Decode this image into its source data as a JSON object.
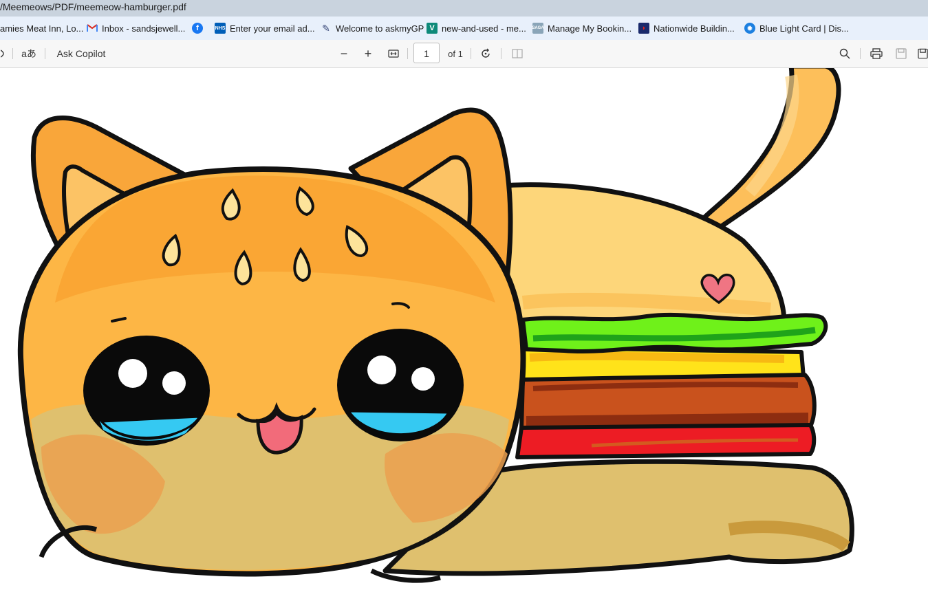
{
  "address": {
    "path": "/Meemeows/PDF/meemeow-hamburger.pdf"
  },
  "bookmarks": [
    {
      "label": "amies Meat Inn, Lo...",
      "icon": "",
      "color": ""
    },
    {
      "label": "Inbox - sandsjewell...",
      "icon": "gmail-icon",
      "color": "#d93025"
    },
    {
      "label": "",
      "icon": "facebook-icon",
      "color": "#1877f2"
    },
    {
      "label": "Enter your email ad...",
      "icon": "nhs-icon",
      "color": "#005eb8"
    },
    {
      "label": "Welcome to askmyGP",
      "icon": "askmygp-icon",
      "color": "#3b4a7a"
    },
    {
      "label": "new-and-used - me...",
      "icon": "v-icon",
      "color": "#0e8a7a"
    },
    {
      "label": "Manage My Bookin...",
      "icon": "saga-icon",
      "color": "#8aa5b8"
    },
    {
      "label": "Nationwide Buildin...",
      "icon": "nationwide-icon",
      "color": "#1a2a6c"
    },
    {
      "label": "Blue Light Card | Dis...",
      "icon": "bluelight-icon",
      "color": "#1b7fe0"
    }
  ],
  "toolbar": {
    "read_aloud_icon": "read-aloud-icon",
    "translate_label": "aあ",
    "copilot_label": "Ask Copilot",
    "zoom_out": "−",
    "zoom_in": "+",
    "page_current": "1",
    "page_total": "of 1"
  },
  "document": {
    "file": "meemeow-hamburger.pdf",
    "image_description": ""
  }
}
